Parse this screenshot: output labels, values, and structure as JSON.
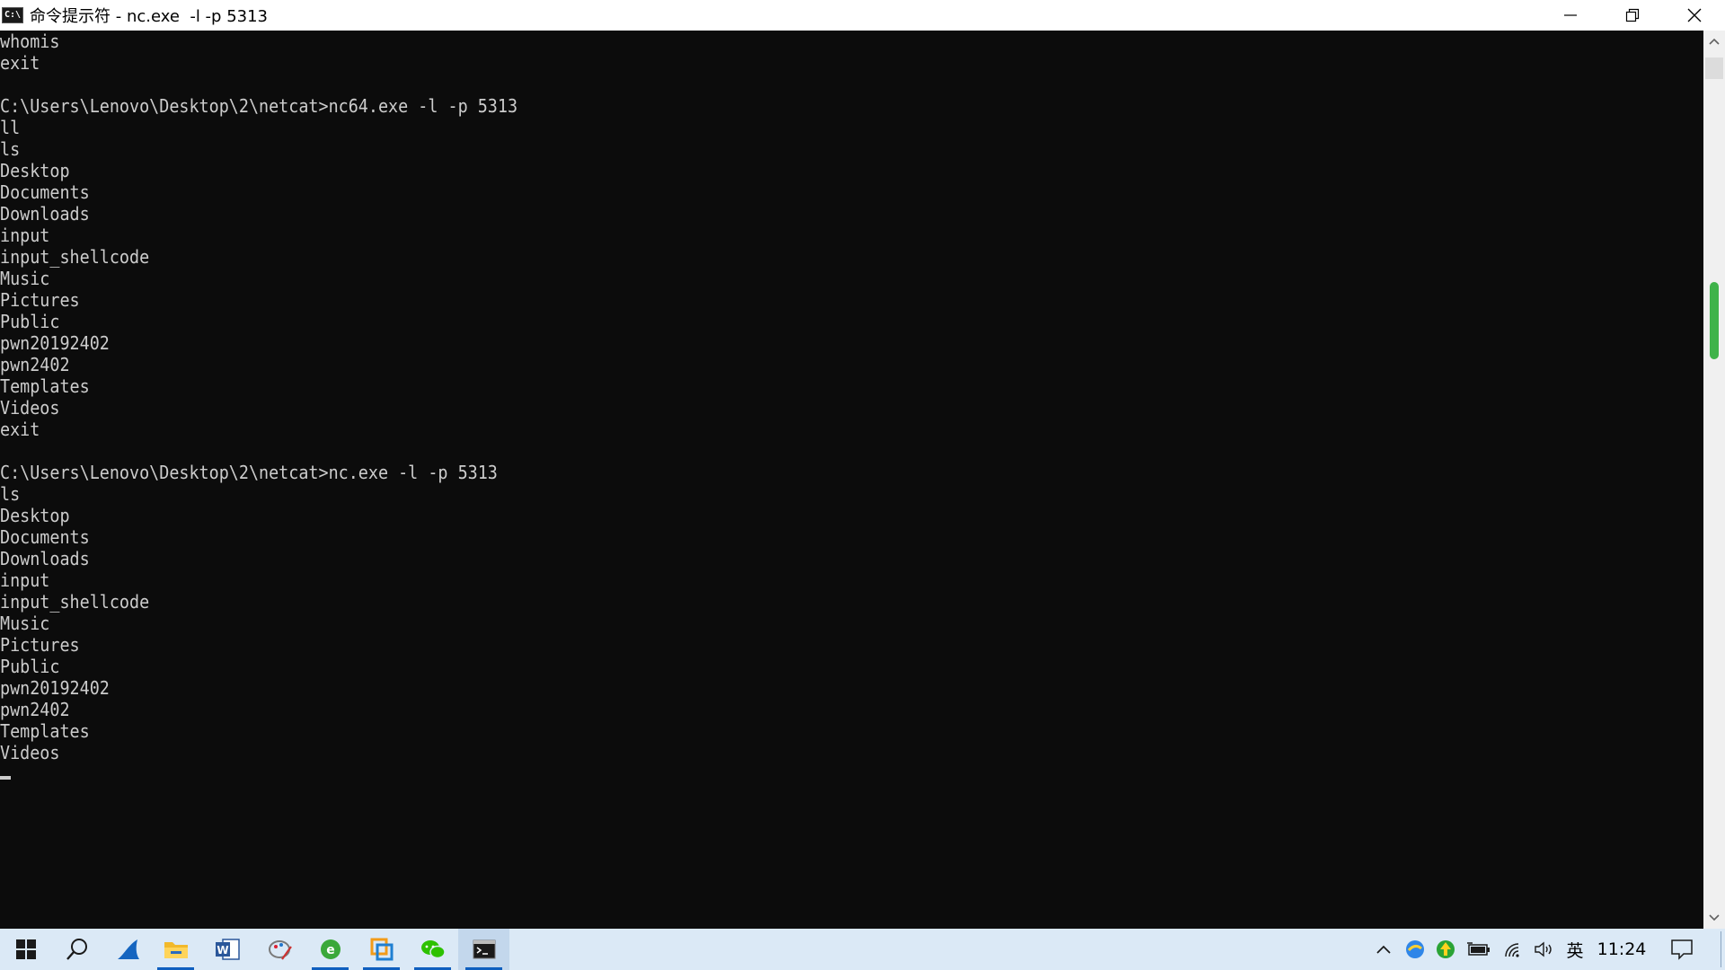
{
  "window": {
    "title": "命令提示符 - nc.exe  -l -p 5313",
    "app_icon_text": "C:\\"
  },
  "console": {
    "lines": [
      "whomis",
      "exit",
      "",
      "C:\\Users\\Lenovo\\Desktop\\2\\netcat>nc64.exe -l -p 5313",
      "ll",
      "ls",
      "Desktop",
      "Documents",
      "Downloads",
      "input",
      "input_shellcode",
      "Music",
      "Pictures",
      "Public",
      "pwn20192402",
      "pwn2402",
      "Templates",
      "Videos",
      "exit",
      "",
      "C:\\Users\\Lenovo\\Desktop\\2\\netcat>nc.exe -l -p 5313",
      "ls",
      "Desktop",
      "Documents",
      "Downloads",
      "input",
      "input_shellcode",
      "Music",
      "Pictures",
      "Public",
      "pwn20192402",
      "pwn2402",
      "Templates",
      "Videos"
    ]
  },
  "taskbar": {
    "apps": [
      {
        "name": "start-button",
        "icon": "windows-logo-icon",
        "active": false,
        "running": false
      },
      {
        "name": "search-button",
        "icon": "search-icon",
        "active": false,
        "running": false
      },
      {
        "name": "taskbar-app-edge-legacy",
        "icon": "shark-fin-icon",
        "active": false,
        "running": false
      },
      {
        "name": "taskbar-app-file-explorer",
        "icon": "folder-icon",
        "active": false,
        "running": true
      },
      {
        "name": "taskbar-app-word",
        "icon": "word-icon",
        "active": false,
        "running": false
      },
      {
        "name": "taskbar-app-paint",
        "icon": "paint-icon",
        "active": false,
        "running": false
      },
      {
        "name": "taskbar-app-browser",
        "icon": "browser-e-icon",
        "active": false,
        "running": true
      },
      {
        "name": "taskbar-app-vmware",
        "icon": "vm-icon",
        "active": false,
        "running": true
      },
      {
        "name": "taskbar-app-wechat",
        "icon": "wechat-icon",
        "active": false,
        "running": true
      },
      {
        "name": "taskbar-app-cmd",
        "icon": "terminal-icon",
        "active": true,
        "running": true
      }
    ],
    "tray": {
      "ime_label": "英",
      "clock": "11:24"
    }
  },
  "colors": {
    "console_bg": "#0c0c0c",
    "console_fg": "#cccccc",
    "taskbar_bg": "#dbe9f6",
    "accent": "#0f5fbf",
    "scroll_thumb": "#3fb34a"
  }
}
